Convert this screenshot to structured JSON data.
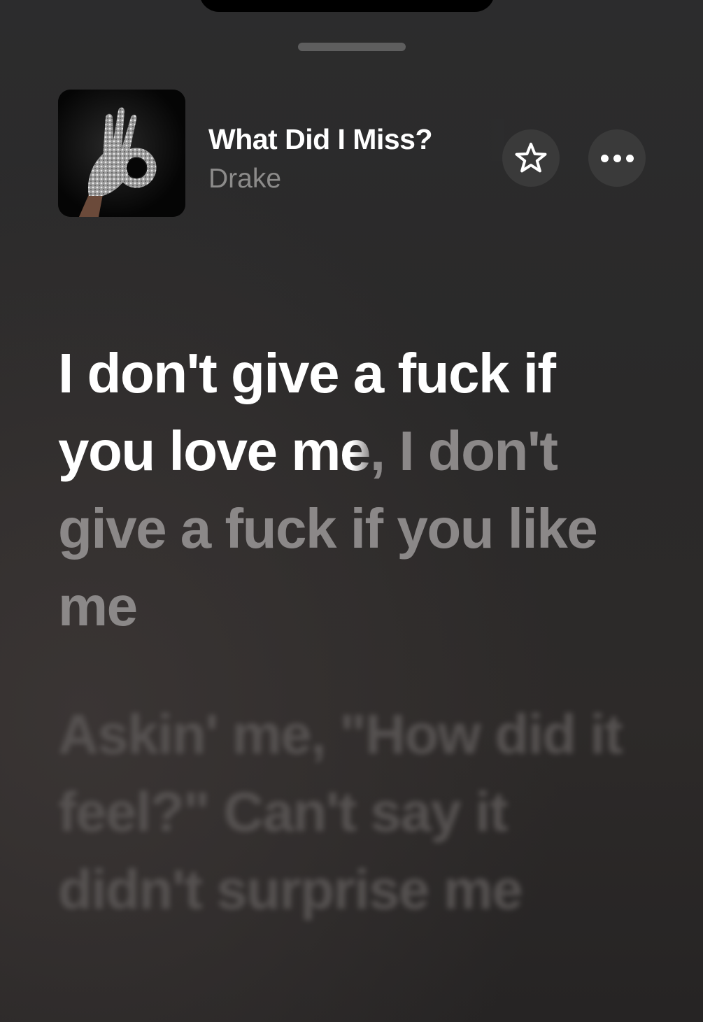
{
  "track": {
    "title": "What Did I Miss?",
    "artist": "Drake",
    "artwork_icon": "ok-hand-glove-artwork"
  },
  "actions": {
    "favorite_icon": "star-icon",
    "more_icon": "ellipsis-icon"
  },
  "lyrics": {
    "current_sung": "I don't give a fuck if you love m",
    "current_partial": "e",
    "current_unsung": ", I don't give a fuck if you like me",
    "next_line": "Askin' me, \"How did it feel?\" Can't say it didn't surprise me"
  },
  "colors": {
    "background": "#2c2c2d",
    "active_text": "#ffffff",
    "upcoming_text": "#8b8888",
    "secondary_text": "#8c8b8a",
    "button_bg": "#3a3a3a"
  }
}
